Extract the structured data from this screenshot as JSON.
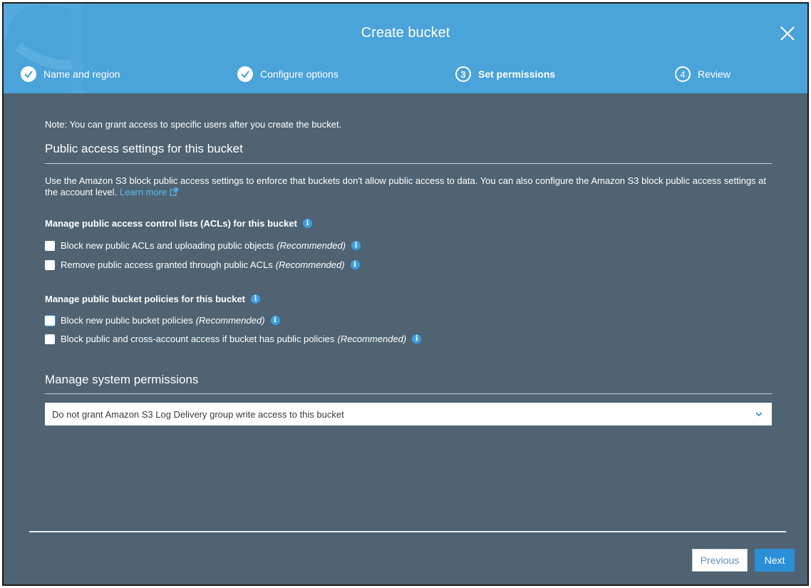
{
  "dialog": {
    "title": "Create bucket",
    "close_icon": "close-icon"
  },
  "steps": [
    {
      "label": "Name and region",
      "state": "done",
      "icon": "check-circle-icon"
    },
    {
      "label": "Configure options",
      "state": "done",
      "icon": "check-circle-icon"
    },
    {
      "label": "Set permissions",
      "state": "active",
      "number": "3"
    },
    {
      "label": "Review",
      "state": "pending",
      "number": "4"
    }
  ],
  "note": "Note: You can grant access to specific users after you create the bucket.",
  "public_access": {
    "heading": "Public access settings for this bucket",
    "description": "Use the Amazon S3 block public access settings to enforce that buckets don't allow public access to data. You can also configure the Amazon S3 block public access settings at the account level.",
    "learn_more": "Learn more",
    "acl_group": {
      "heading": "Manage public access control lists (ACLs) for this bucket",
      "options": [
        {
          "label": "Block new public ACLs and uploading public objects",
          "tag": "(Recommended)",
          "checked": false
        },
        {
          "label": "Remove public access granted through public ACLs",
          "tag": "(Recommended)",
          "checked": false
        }
      ]
    },
    "policy_group": {
      "heading": "Manage public bucket policies for this bucket",
      "options": [
        {
          "label": "Block new public bucket policies",
          "tag": "(Recommended)",
          "checked": false
        },
        {
          "label": "Block public and cross-account access if bucket has public policies",
          "tag": "(Recommended)",
          "checked": false
        }
      ]
    }
  },
  "system_permissions": {
    "heading": "Manage system permissions",
    "select_value": "Do not grant Amazon S3 Log Delivery group write access to this bucket"
  },
  "footer": {
    "previous_label": "Previous",
    "next_label": "Next"
  },
  "colors": {
    "header": "#4aa3d9",
    "body": "#4f6372",
    "accent": "#2a8fd6",
    "link": "#5dbbf0"
  }
}
